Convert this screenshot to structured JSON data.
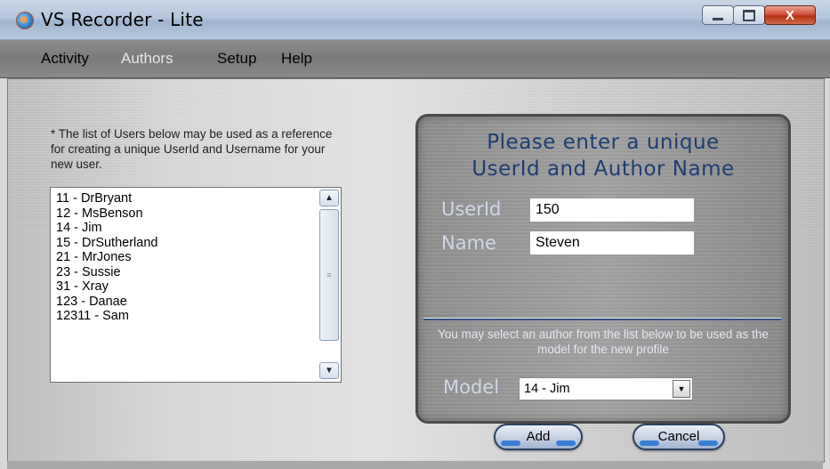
{
  "window": {
    "title": "VS Recorder - Lite",
    "icon": "globe-app-icon",
    "controls": {
      "minimize": "minimize-icon",
      "maximize": "maximize-icon",
      "close_label": "X"
    }
  },
  "menubar": {
    "items": [
      {
        "label": "Activity",
        "active": false
      },
      {
        "label": "Authors",
        "active": true
      },
      {
        "label": "Setup",
        "active": false
      },
      {
        "label": "Help",
        "active": false
      }
    ]
  },
  "left": {
    "hint": "* The list of Users below may be used as a reference for creating a unique UserId and Username for your new user.",
    "users": [
      "11 - DrBryant",
      "12 - MsBenson",
      "14 - Jim",
      "15 - DrSutherland",
      "21 - MrJones",
      "23 - Sussie",
      "31 - Xray",
      "123 - Danae",
      "12311 - Sam"
    ]
  },
  "panel": {
    "title_line1": "Please enter a unique",
    "title_line2": "UserId and Author Name",
    "userid_label": "UserId",
    "userid_value": "150",
    "name_label": "Name",
    "name_value": "Steven",
    "note": "You may select an author from the list below to be used as the model for the new profile",
    "model_label": "Model",
    "model_value": "14 - Jim",
    "add_label": "Add",
    "cancel_label": "Cancel"
  },
  "colors": {
    "panel_title": "#1d3d73",
    "label_text": "#cfd7e6",
    "button_accent": "#3a7fd6",
    "close_button": "#c7432a"
  }
}
